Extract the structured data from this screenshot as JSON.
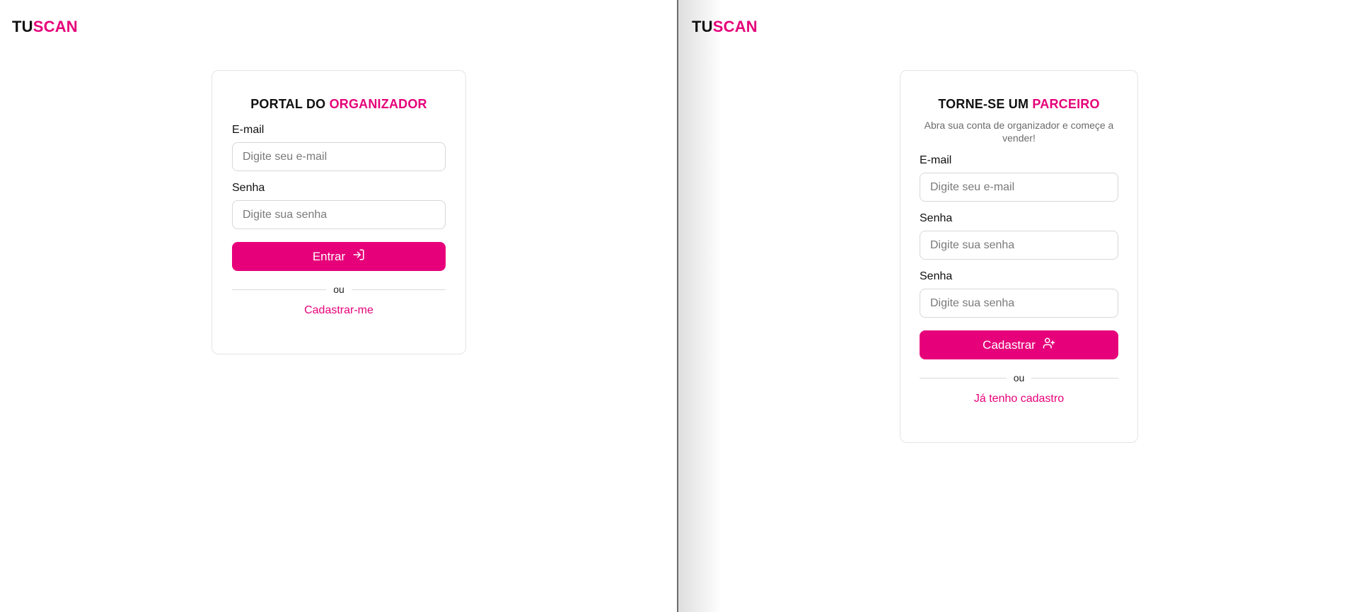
{
  "brand": {
    "part1": "TU",
    "part2": "SCAN",
    "accent_color": "#e6007a"
  },
  "login": {
    "title_part1": "PORTAL DO ",
    "title_accent": "ORGANIZADOR",
    "email_label": "E-mail",
    "email_placeholder": "Digite seu e-mail",
    "password_label": "Senha",
    "password_placeholder": "Digite sua senha",
    "submit_label": "Entrar",
    "submit_icon": "login-icon",
    "divider_text": "ou",
    "link_label": "Cadastrar-me"
  },
  "register": {
    "title_part1": "TORNE-SE UM ",
    "title_accent": "PARCEIRO",
    "subtitle": "Abra sua conta de organizador e começe a vender!",
    "email_label": "E-mail",
    "email_placeholder": "Digite seu e-mail",
    "password_label": "Senha",
    "password_placeholder": "Digite sua senha",
    "confirm_label": "Senha",
    "confirm_placeholder": "Digite sua senha",
    "submit_label": "Cadastrar",
    "submit_icon": "user-plus-icon",
    "divider_text": "ou",
    "link_label": "Já tenho cadastro"
  }
}
